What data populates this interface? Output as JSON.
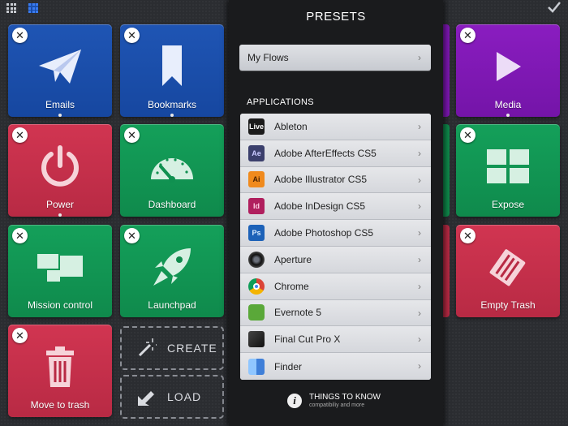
{
  "tiles": {
    "emails": "Emails",
    "bookmarks": "Bookmarks",
    "media": "Media",
    "power": "Power",
    "dashboard": "Dashboard",
    "expose": "Expose",
    "mission_control": "Mission control",
    "launchpad": "Launchpad",
    "empty_trash": "Empty Trash",
    "move_to_trash": "Move to trash"
  },
  "close_glyph": "✕",
  "actions": {
    "create": "CREATE",
    "load": "LOAD"
  },
  "panel": {
    "title": "PRESETS",
    "my_flows": "My Flows",
    "section_title": "APPLICATIONS",
    "apps": [
      {
        "name": "Ableton",
        "icon": "ableton-icon",
        "glyph": "Live",
        "bg": "#1b1b1b",
        "fg": "#ffffff"
      },
      {
        "name": "Adobe AfterEffects CS5",
        "icon": "after-effects-icon",
        "glyph": "Ae",
        "bg": "#3b3f6c",
        "fg": "#c9c9ff"
      },
      {
        "name": "Adobe Illustrator CS5",
        "icon": "illustrator-icon",
        "glyph": "Ai",
        "bg": "#f08a1d",
        "fg": "#4a2200"
      },
      {
        "name": "Adobe InDesign CS5",
        "icon": "indesign-icon",
        "glyph": "Id",
        "bg": "#b01f5e",
        "fg": "#ffd0e4"
      },
      {
        "name": "Adobe Photoshop CS5",
        "icon": "photoshop-icon",
        "glyph": "Ps",
        "bg": "#1d62b8",
        "fg": "#d8ebff"
      },
      {
        "name": "Aperture",
        "icon": "aperture-icon",
        "glyph": "",
        "bg": "#333333",
        "fg": "#ffffff"
      },
      {
        "name": "Chrome",
        "icon": "chrome-icon",
        "glyph": "",
        "bg": "#ffffff",
        "fg": "#000000"
      },
      {
        "name": "Evernote 5",
        "icon": "evernote-icon",
        "glyph": "",
        "bg": "#5aa839",
        "fg": "#ffffff"
      },
      {
        "name": "Final Cut Pro X",
        "icon": "final-cut-icon",
        "glyph": "",
        "bg": "#2a2a2a",
        "fg": "#ffffff"
      },
      {
        "name": "Finder",
        "icon": "finder-icon",
        "glyph": "",
        "bg": "#4d8fe0",
        "fg": "#ffffff"
      }
    ],
    "chevron": "›",
    "info_glyph": "i",
    "info_title": "THINGS TO KNOW",
    "info_sub": "compatibiliy and more"
  }
}
